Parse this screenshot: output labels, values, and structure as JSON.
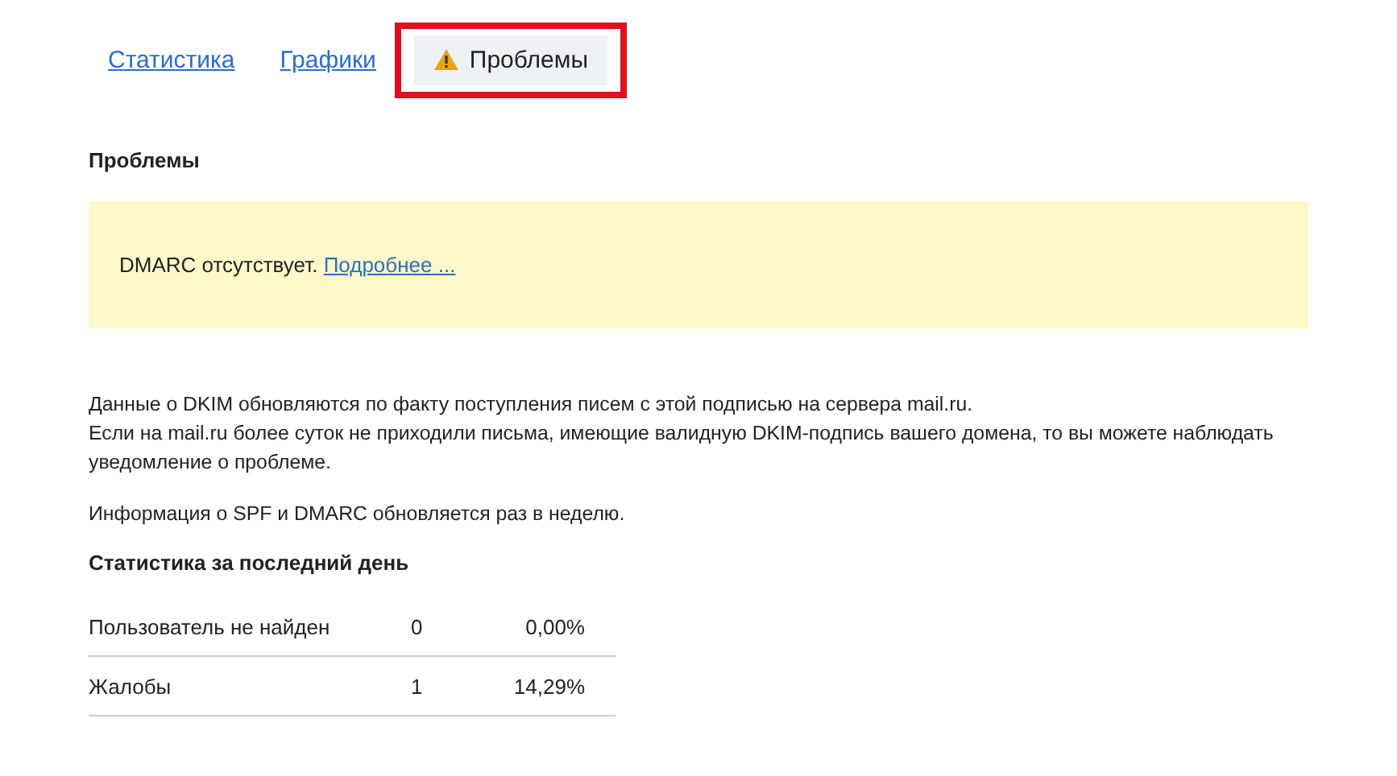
{
  "tabs": [
    {
      "label": "Статистика",
      "selected": false,
      "highlighted": false,
      "warning": false
    },
    {
      "label": "Графики",
      "selected": false,
      "highlighted": false,
      "warning": false
    },
    {
      "label": "Проблемы",
      "selected": true,
      "highlighted": true,
      "warning": true
    }
  ],
  "problems": {
    "title": "Проблемы",
    "alert": {
      "text": "DMARC отсутствует.",
      "link": "Подробнее ..."
    }
  },
  "notes": [
    "Данные о DKIM обновляются по факту поступления писем с этой подписью на сервера mail.ru.\nЕсли на mail.ru более суток не приходили письма, имеющие валидную DKIM-подпись вашего домена, то вы можете наблюдать уведомление о проблеме.",
    "Информация о SPF и DMARC обновляется раз в неделю."
  ],
  "stats": {
    "title": "Статистика за последний день",
    "rows": [
      {
        "label": "Пользователь не найден",
        "count": "0",
        "percent": "0,00%"
      },
      {
        "label": "Жалобы",
        "count": "1",
        "percent": "14,29%"
      }
    ]
  }
}
